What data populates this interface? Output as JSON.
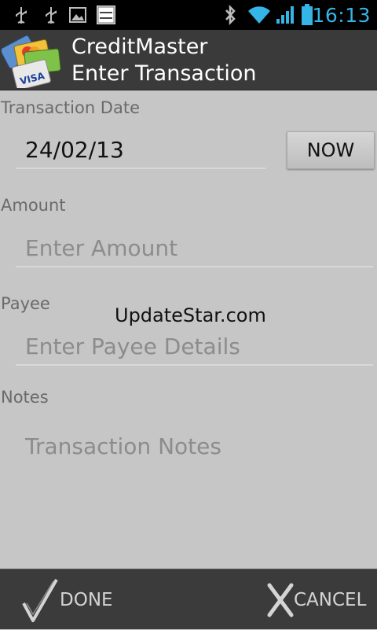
{
  "status_bar": {
    "time": "16:13",
    "notification_icons": [
      "usb-icon",
      "usb-icon",
      "picture-icon",
      "basics-android-icon"
    ],
    "system_icons": [
      "bluetooth-icon",
      "wifi-icon",
      "signal-icon",
      "battery-icon"
    ],
    "mini_icon_text": "Basics Android",
    "accent_color": "#35b5e5"
  },
  "header": {
    "app_name": "CreditMaster",
    "screen_title": "Enter Transaction",
    "logo_card_text": "VISA"
  },
  "form": {
    "date_label": "Transaction Date",
    "date_value": "24/02/13",
    "now_button": "NOW",
    "amount_label": "Amount",
    "amount_placeholder": "Enter Amount",
    "payee_label": "Payee",
    "payee_placeholder": "Enter Payee Details",
    "notes_label": "Notes",
    "notes_placeholder": "Transaction Notes"
  },
  "watermark": "UpdateStar.com",
  "bottom_bar": {
    "done_label": "DONE",
    "done_icon": "checkmark-icon",
    "cancel_label": "CANCEL",
    "cancel_icon": "x-icon"
  }
}
